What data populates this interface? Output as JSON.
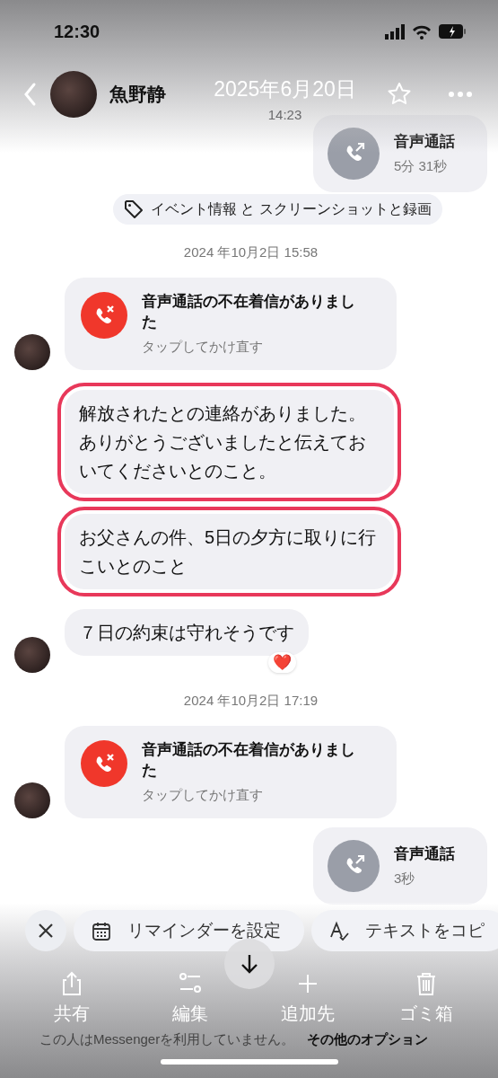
{
  "status_bar": {
    "time": "12:30"
  },
  "photo_header": {
    "date": "2025年6月20日",
    "time": "14:23"
  },
  "chat_header": {
    "name": "魚野静"
  },
  "messages": [
    {
      "kind": "call",
      "title": "音声通話",
      "detail": "5分 31秒"
    },
    {
      "kind": "tag",
      "text": "イベント情報 と スクリーンショットと録画"
    },
    {
      "kind": "timestamp",
      "text": "2024 年10月2日 15:58"
    },
    {
      "kind": "missed_call",
      "title": "音声通話の不在着信がありました",
      "detail": "タップしてかけ直す",
      "avatar": true
    },
    {
      "kind": "text",
      "text": "解放されたとの連絡がありました。ありがとうございましたと伝えておいてくださいとのこと。",
      "highlighted": true,
      "avatar": false
    },
    {
      "kind": "text",
      "text": "お父さんの件、5日の夕方に取りに行こいとのこと",
      "highlighted": true,
      "avatar": false
    },
    {
      "kind": "text",
      "text": "７日の約束は守れそうです",
      "highlighted": false,
      "avatar": true,
      "reaction": "❤️"
    },
    {
      "kind": "timestamp",
      "text": "2024 年10月2日 17:19"
    },
    {
      "kind": "missed_call",
      "title": "音声通話の不在着信がありました",
      "detail": "タップしてかけ直す",
      "avatar": true
    },
    {
      "kind": "call",
      "title": "音声通話",
      "detail": "3秒"
    }
  ],
  "action_chips": [
    {
      "kind": "reminder",
      "label": "リマインダーを設定"
    },
    {
      "kind": "copy",
      "label": "テキストをコピ"
    }
  ],
  "toolbar": [
    {
      "kind": "share",
      "label": "共有"
    },
    {
      "kind": "edit",
      "label": "編集"
    },
    {
      "kind": "add",
      "label": "追加先"
    },
    {
      "kind": "trash",
      "label": "ゴミ箱"
    }
  ],
  "footer": {
    "notice": "この人はMessengerを利用していません。",
    "link": "その他のオプション"
  }
}
